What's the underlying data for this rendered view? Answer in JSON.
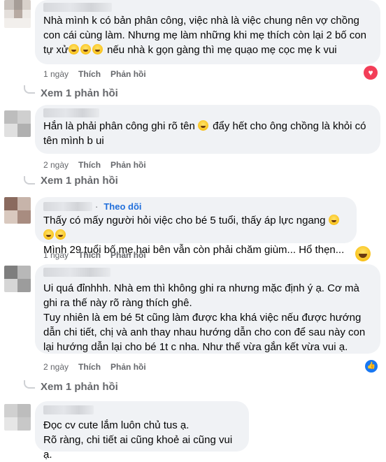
{
  "comments": [
    {
      "text": "Nhà mình k có bản phân công, việc nhà là việc chung nên vợ chồng\ncon cái cùng làm. Nhưng mẹ làm những khi mẹ thích còn lại 2 bố con\ntự xử",
      "text_tail": " nếu nhà k gọn gàng thì mẹ quạo mẹ cọc mẹ k vui",
      "time": "1 ngày",
      "like": "Thích",
      "reply": "Phản hồi",
      "reaction_icon": "love-reaction-icon",
      "replies_label": "Xem 1 phản hồi"
    },
    {
      "text_head": "Hắn là phải phân công ghi rõ tên",
      "text_tail": " đẩy hết cho ông chồng là khỏi có\ntên mình b ui",
      "time": "2 ngày",
      "like": "Thích",
      "reply": "Phản hồi",
      "replies_label": "Xem 1 phản hồi"
    },
    {
      "follow": "Theo dõi",
      "text_head": "Thấy có mấy người hỏi việc cho bé 5 tuổi, thấy áp lực ngang",
      "text_tail": "Mình 29 tuổi bố mẹ hai bên vẫn còn phải chăm giùm... Hổ thẹn...",
      "time": "1 ngày",
      "like": "Thích",
      "reply": "Phản hồi",
      "reaction_icon": "haha-reaction-icon"
    },
    {
      "text": "Ui quá đỉnhhh. Nhà em thì không ghi ra nhưng mặc định ý ạ. Cơ mà\nghi ra thế này rõ ràng thích ghê.\nTuy nhiên là em bé 5t cũng làm được kha khá việc nếu được hướng\ndẫn chi tiết, chị và anh thay nhau hướng dẫn cho con để sau này con\nlại hướng dẫn lại cho bé 1t c nha. Như thế vừa gắn kết vừa vui ạ.",
      "time": "2 ngày",
      "like": "Thích",
      "reply": "Phản hồi",
      "reaction_icon": "like-reaction-icon",
      "replies_label": "Xem 1 phản hồi"
    },
    {
      "text": "Đọc cv cute lắm luôn chủ tus ạ.\nRõ ràng, chi tiết ai cũng khoẻ ai cũng vui ạ."
    }
  ]
}
